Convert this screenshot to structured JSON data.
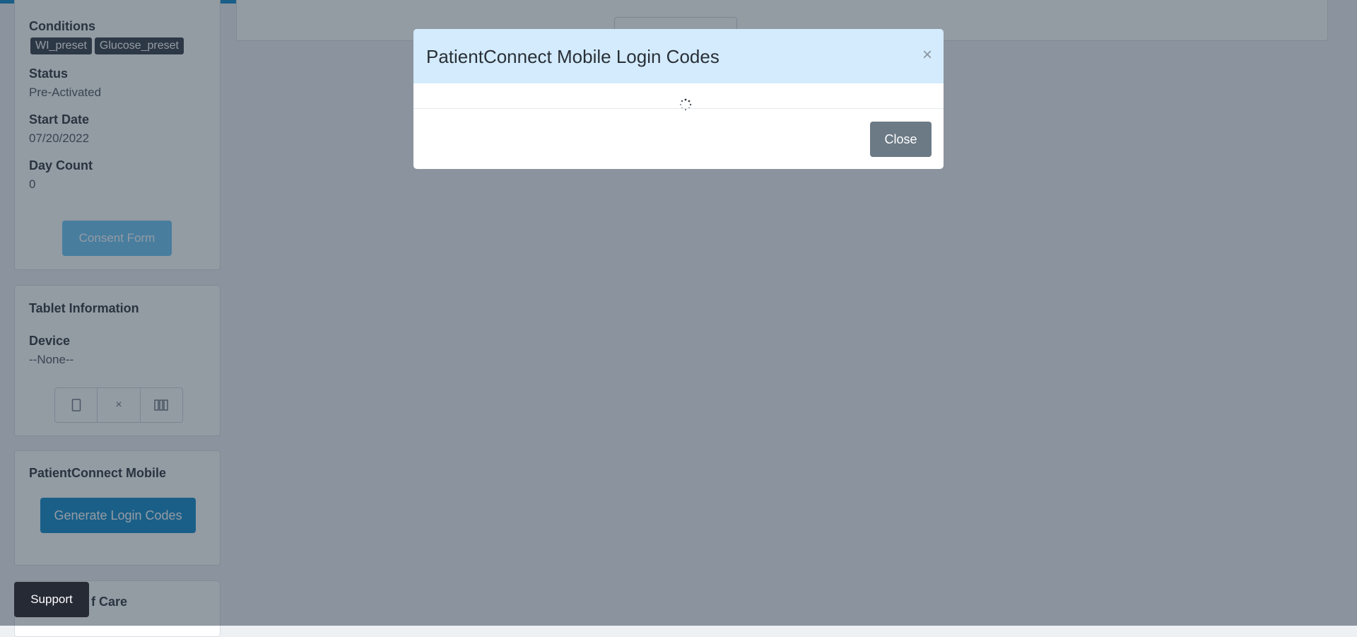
{
  "patient_card": {
    "conditions_label": "Conditions",
    "conditions": [
      "WI_preset",
      "Glucose_preset"
    ],
    "status_label": "Status",
    "status_value": "Pre-Activated",
    "start_date_label": "Start Date",
    "start_date_value": "07/20/2022",
    "day_count_label": "Day Count",
    "day_count_value": "0",
    "consent_button": "Consent Form"
  },
  "tablet_card": {
    "title": "Tablet Information",
    "device_label": "Device",
    "device_value": "--None--",
    "device_actions": [
      "tablet-icon",
      "close-icon",
      "barcode-icon"
    ],
    "remove_glyph": "×"
  },
  "mobile_card": {
    "title": "PatientConnect Mobile",
    "generate_button": "Generate Login Codes"
  },
  "care_card": {
    "title_partial": "f Care"
  },
  "support_button": "Support",
  "modal": {
    "title": "PatientConnect Mobile Login Codes",
    "close_x": "×",
    "loading_icon": "spinner-icon",
    "close_button": "Close"
  },
  "colors": {
    "primary": "#0d86c9",
    "primary_disabled": "#69c2f5",
    "modal_header": "#d3ebfc",
    "tag_bg": "#333844",
    "support_bg": "#262a35",
    "secondary_btn": "#6c7a86"
  }
}
